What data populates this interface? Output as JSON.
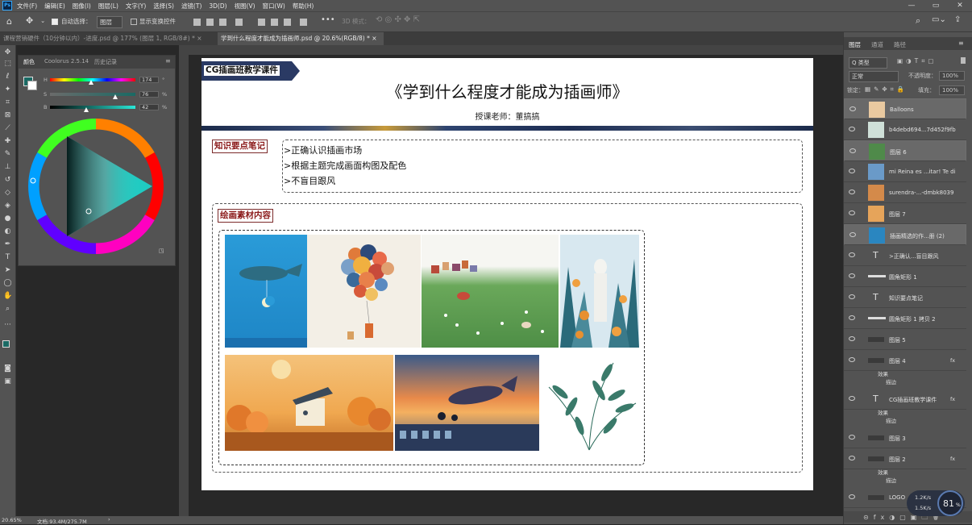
{
  "app": {
    "logo": "Ps"
  },
  "menu": [
    "文件(F)",
    "编辑(E)",
    "图像(I)",
    "图层(L)",
    "文字(Y)",
    "选择(S)",
    "滤镜(T)",
    "3D(D)",
    "视图(V)",
    "窗口(W)",
    "帮助(H)"
  ],
  "window_controls": [
    "—",
    "▭",
    "✕"
  ],
  "options": {
    "home_icon": "home-icon",
    "move_icon": "move-icon",
    "auto_select_label": "自动选择：",
    "auto_select_value": "图层",
    "show_transform_label": "显示变换控件",
    "mode_3d": "3D 模式："
  },
  "tabs": [
    {
      "label": "课程营销硬件（10分钟以内）-进度.psd @ 177% (图层 1, RGB/8#) *",
      "active": false
    },
    {
      "label": "学到什么程度才能成为插画师.psd @ 20.6%(RGB/8) *",
      "active": true
    }
  ],
  "color_panel": {
    "tabs": [
      "颜色",
      "Coolorus 2.5.14",
      "历史记录"
    ],
    "h": {
      "label": "H",
      "value": "174",
      "unit": "°",
      "pos": 0.48
    },
    "s": {
      "label": "S",
      "value": "76",
      "unit": "%",
      "pos": 0.76
    },
    "b": {
      "label": "B",
      "value": "42",
      "unit": "%",
      "pos": 0.42
    },
    "fg_color": "#1a6a64"
  },
  "document": {
    "tag": "CG插画班教学课件",
    "title": "《学到什么程度才能成为插画师》",
    "teacher": "授课老师：董搞搞",
    "section1_label": "知识要点笔记",
    "notes": [
      ">正确认识插画市场",
      ">根据主题完成画面构图及配色",
      ">不盲目跟风"
    ],
    "section2_label": "绘画素材内容"
  },
  "panels": {
    "tabs": [
      "图层",
      "通道",
      "路径"
    ],
    "filter_label": "Q 类型",
    "blend_mode": "正常",
    "opacity_label": "不透明度：",
    "opacity_value": "100%",
    "lock_label": "锁定：",
    "fill_label": "填充：",
    "fill_value": "100%"
  },
  "layers": [
    {
      "name": "Balloons",
      "type": "image",
      "selected": true,
      "color": "#e9c9a0"
    },
    {
      "name": "b4debd694...7d452f9fb",
      "type": "image",
      "selected": false,
      "color": "#cfe0d8"
    },
    {
      "name": "图层 6",
      "type": "image",
      "selected": true,
      "color": "#4f8a4a"
    },
    {
      "name": "mi Reina es ...itar! Te di",
      "type": "image",
      "selected": false,
      "color": "#6a9ac8"
    },
    {
      "name": "surendra-...-dmbk8039",
      "type": "image",
      "selected": false,
      "color": "#d48a4a"
    },
    {
      "name": "图层 7",
      "type": "image",
      "selected": false,
      "color": "#e6a45a"
    },
    {
      "name": "插画精选的作...册 (2)",
      "type": "image",
      "selected": true,
      "color": "#2a86c0"
    },
    {
      "name": ">正确认...盲目跟风",
      "type": "text",
      "selected": false
    },
    {
      "name": "圆角矩形 1",
      "type": "shape",
      "selected": false
    },
    {
      "name": "知识要点笔记",
      "type": "text",
      "selected": false
    },
    {
      "name": "圆角矩形 1 拷贝 2",
      "type": "shape",
      "selected": false
    },
    {
      "name": "图层 5",
      "type": "image",
      "selected": false
    },
    {
      "name": "图层 4",
      "type": "image",
      "selected": false,
      "fx": "fx",
      "effects": [
        "效果",
        "描边"
      ]
    },
    {
      "name": "CG插画班教学课件",
      "type": "text",
      "selected": false,
      "fx": "fx",
      "effects": [
        "效果",
        "描边"
      ]
    },
    {
      "name": "图层 3",
      "type": "image",
      "selected": false
    },
    {
      "name": "图层 2",
      "type": "image",
      "selected": false,
      "fx": "fx",
      "effects": [
        "效果",
        "描边"
      ]
    },
    {
      "name": "LOGO",
      "type": "image",
      "selected": false
    }
  ],
  "status": {
    "zoom": "20.65%",
    "doc": "文档:93.4M/275.7M"
  },
  "network": {
    "up": "1.2K/s",
    "down": "1.5K/s",
    "percent": "81",
    "unit": "%"
  }
}
